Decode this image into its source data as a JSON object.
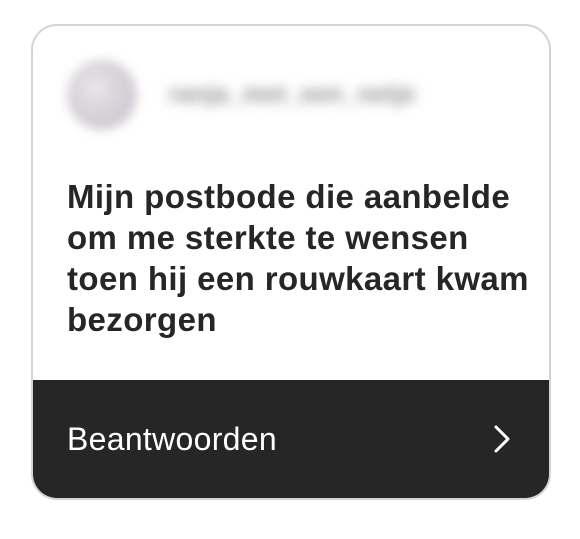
{
  "header": {
    "username": "ranja_met_een_netje",
    "avatar_icon": "avatar-image"
  },
  "question": {
    "text": "Mijn postbode die aanbelde om me sterkte te wensen toen hij een rouwkaart kwam bezorgen"
  },
  "reply": {
    "label": "Beantwoorden",
    "icon": "chevron-right-icon"
  },
  "colors": {
    "card_background": "#ffffff",
    "card_border": "#d4d4d4",
    "question_text": "#262626",
    "reply_bar": "#262626",
    "reply_text": "#ffffff"
  }
}
